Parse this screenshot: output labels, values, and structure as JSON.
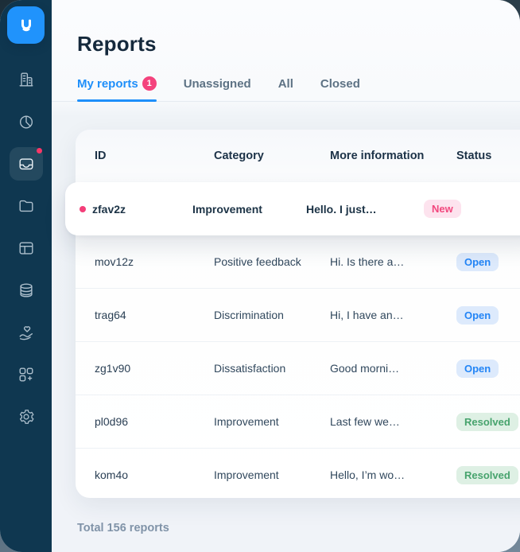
{
  "header": {
    "title": "Reports"
  },
  "tabs": [
    {
      "label": "My reports",
      "badge": "1",
      "active": true
    },
    {
      "label": "Unassigned",
      "active": false
    },
    {
      "label": "All",
      "active": false
    },
    {
      "label": "Closed",
      "active": false
    }
  ],
  "sidebar": {
    "logo_icon": "usersnap-logo",
    "items": [
      {
        "icon": "building-icon",
        "active": false
      },
      {
        "icon": "pie-chart-icon",
        "active": false
      },
      {
        "icon": "inbox-icon",
        "active": true,
        "notification_dot": true
      },
      {
        "icon": "folder-icon",
        "active": false
      },
      {
        "icon": "board-icon",
        "active": false
      },
      {
        "icon": "database-icon",
        "active": false
      },
      {
        "icon": "hand-heart-icon",
        "active": false
      },
      {
        "icon": "apps-add-icon",
        "active": false
      },
      {
        "icon": "settings-icon",
        "active": false
      }
    ]
  },
  "table": {
    "columns": [
      "ID",
      "Category",
      "More information",
      "Status"
    ],
    "rows": [
      {
        "id": "zfav2z",
        "category": "Improvement",
        "info": "Hello. I just…",
        "status": "New",
        "highlighted": true,
        "unread_dot": true
      },
      {
        "id": "mov12z",
        "category": "Positive feedback",
        "info": "Hi. Is there a…",
        "status": "Open"
      },
      {
        "id": "trag64",
        "category": "Discrimination",
        "info": "Hi, I have an…",
        "status": "Open"
      },
      {
        "id": "zg1v90",
        "category": "Dissatisfaction",
        "info": "Good morni…",
        "status": "Open"
      },
      {
        "id": "pl0d96",
        "category": "Improvement",
        "info": "Last few we…",
        "status": "Resolved"
      },
      {
        "id": "kom4o",
        "category": "Improvement",
        "info": "Hello, I’m wo…",
        "status": "Resolved"
      }
    ]
  },
  "footer": {
    "total_label": "Total 156 reports"
  },
  "colors": {
    "accent_blue": "#1E8FFA",
    "logo_blue": "#2093FC",
    "sidebar_bg": "#0F3750",
    "notification_pink": "#F4437D",
    "badge_new_bg": "#FDE3EE",
    "badge_new_text": "#F2487E",
    "badge_open_bg": "#DDEAFC",
    "badge_open_text": "#2385F6",
    "badge_resolved_bg": "#DEF0E4",
    "badge_resolved_text": "#47A36D"
  }
}
